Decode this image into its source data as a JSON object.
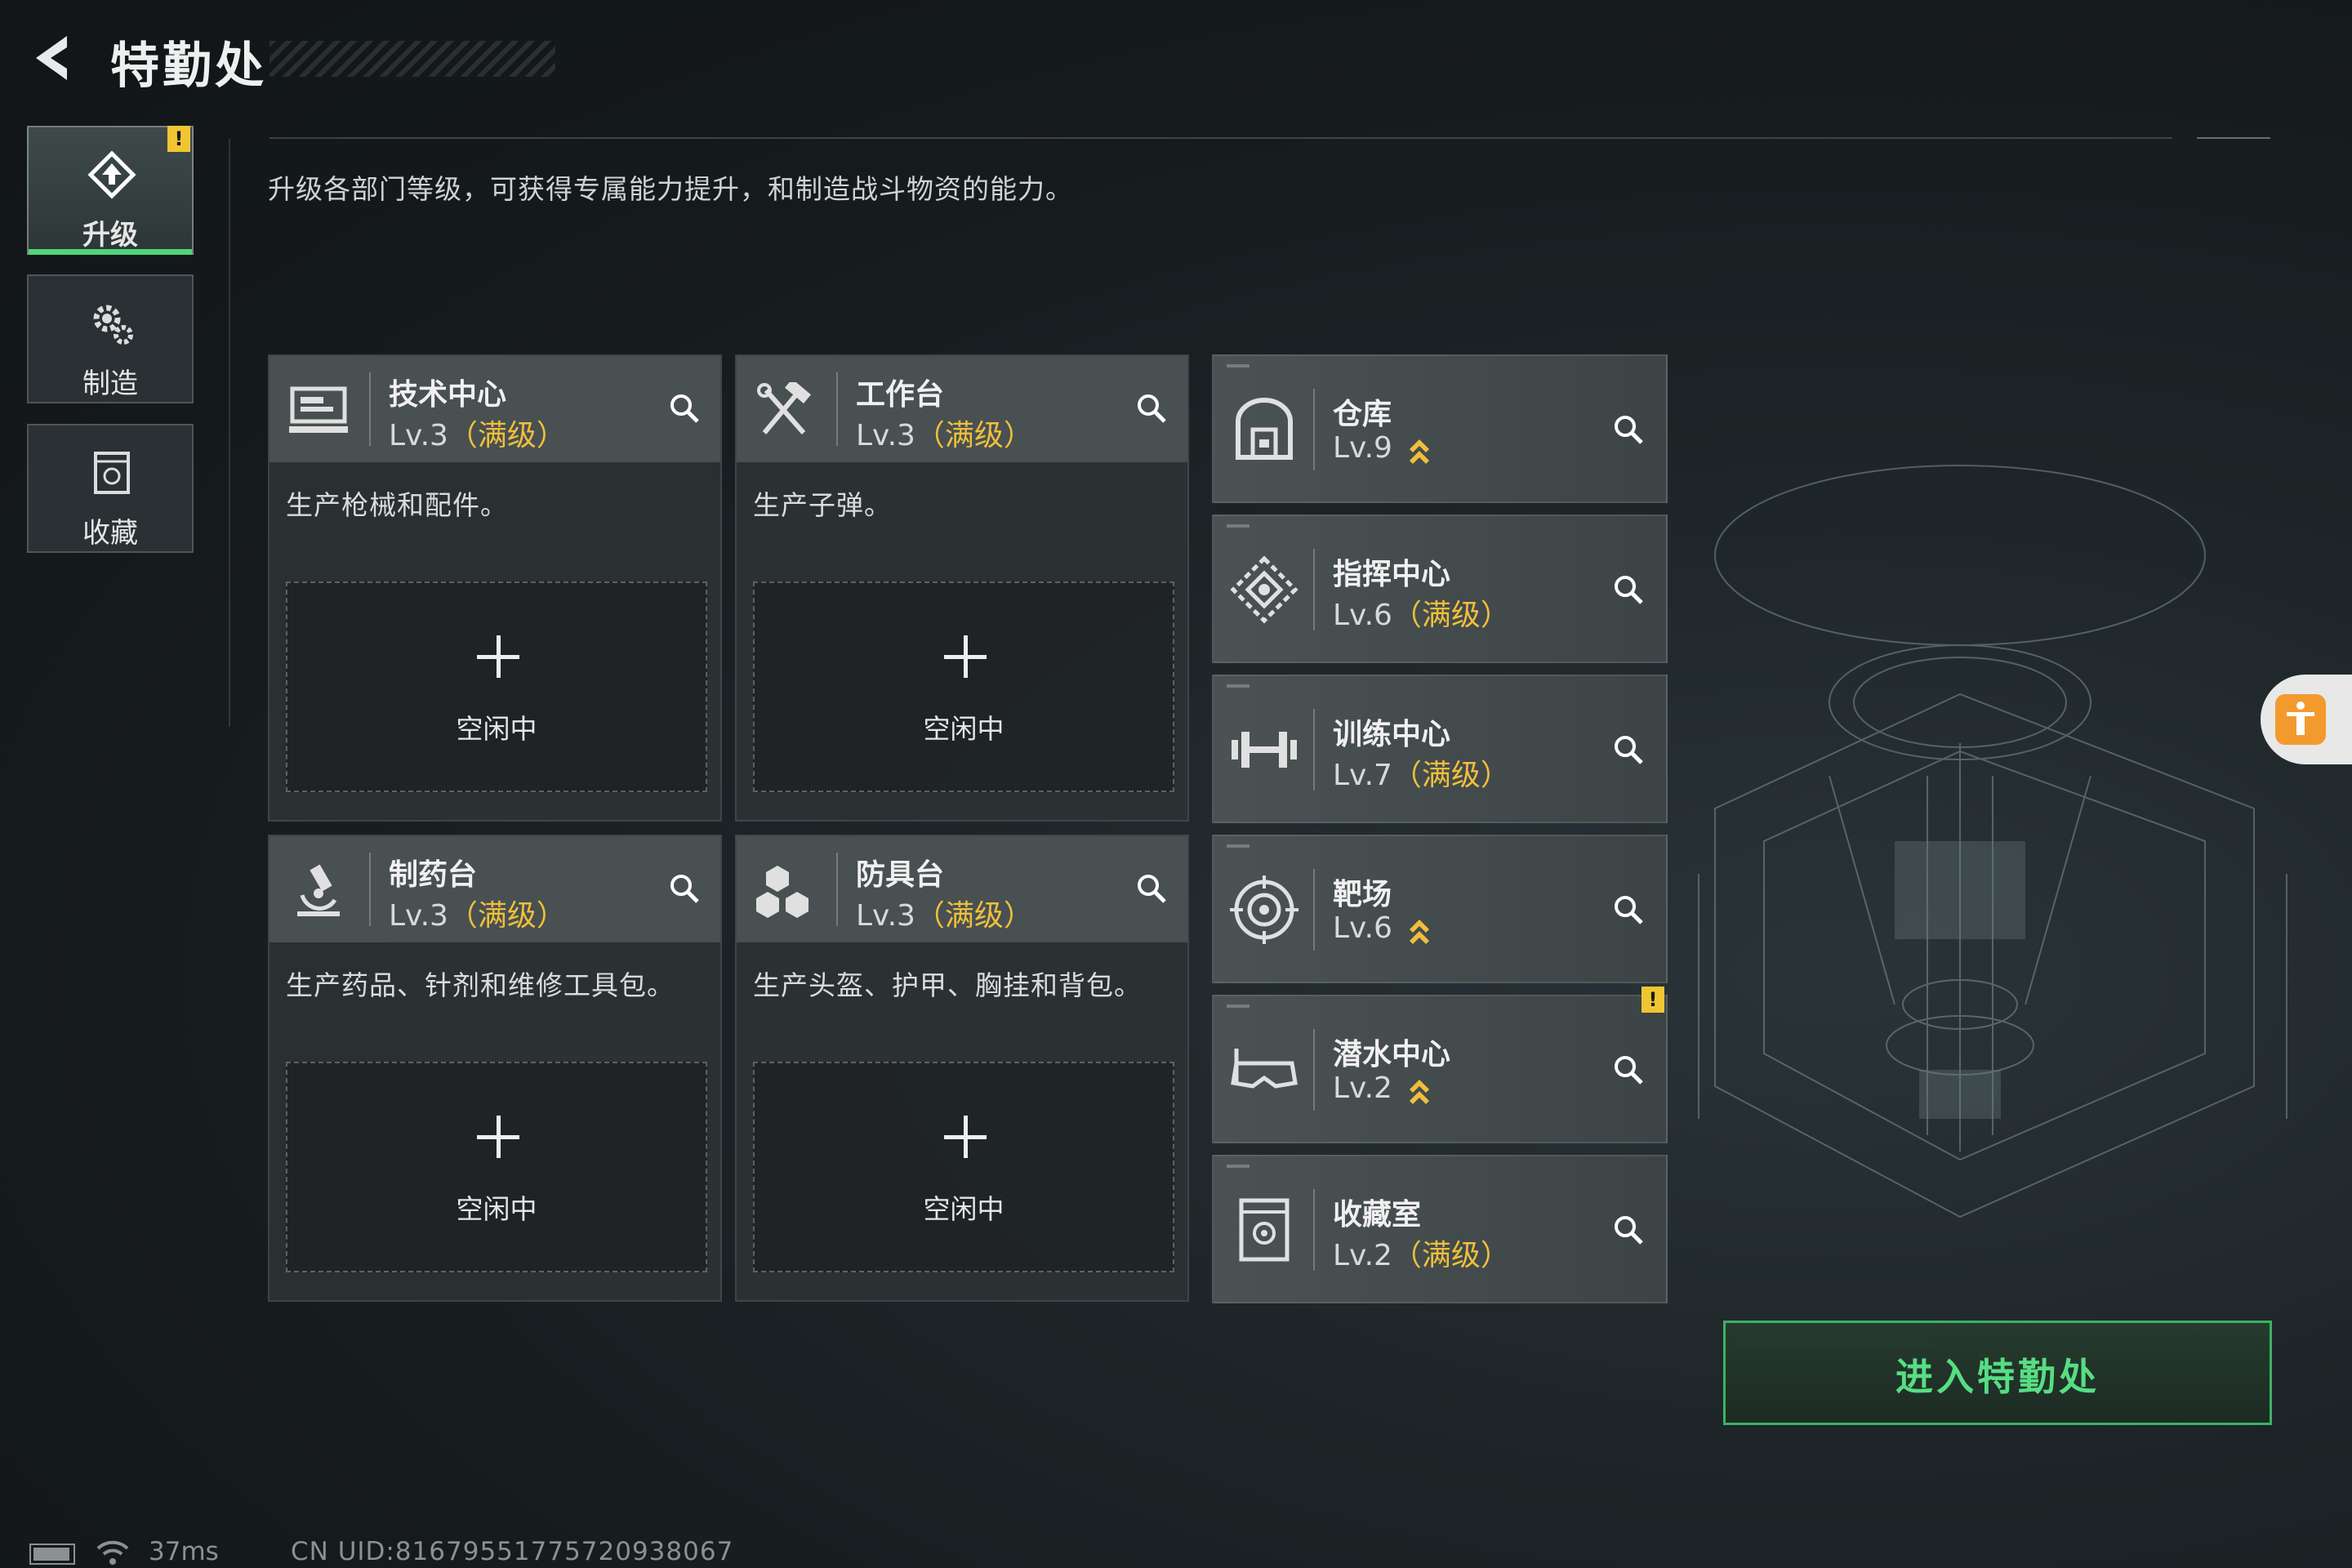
{
  "header": {
    "title": "特勤处"
  },
  "description": "升级各部门等级，可获得专属能力提升，和制造战斗物资的能力。",
  "nav": [
    {
      "label": "升级",
      "icon": "upgrade-icon",
      "active": true,
      "alert": "!"
    },
    {
      "label": "制造",
      "icon": "gears-icon",
      "active": false
    },
    {
      "label": "收藏",
      "icon": "vault-icon",
      "active": false
    }
  ],
  "cards": [
    {
      "name": "技术中心",
      "level": "Lv.3",
      "max": "（满级）",
      "desc": "生产枪械和配件。",
      "slot_label": "空闲中",
      "icon": "computer-icon"
    },
    {
      "name": "工作台",
      "level": "Lv.3",
      "max": "（满级）",
      "desc": "生产子弹。",
      "slot_label": "空闲中",
      "icon": "tools-icon"
    },
    {
      "name": "制药台",
      "level": "Lv.3",
      "max": "（满级）",
      "desc": "生产药品、针剂和维修工具包。",
      "slot_label": "空闲中",
      "icon": "microscope-icon"
    },
    {
      "name": "防具台",
      "level": "Lv.3",
      "max": "（满级）",
      "desc": "生产头盔、护甲、胸挂和背包。",
      "slot_label": "空闲中",
      "icon": "armor-boxes-icon"
    }
  ],
  "facilities": [
    {
      "name": "仓库",
      "level": "Lv.9",
      "max": "",
      "upgradable": true,
      "icon": "warehouse-icon"
    },
    {
      "name": "指挥中心",
      "level": "Lv.6",
      "max": "（满级）",
      "upgradable": false,
      "icon": "command-icon"
    },
    {
      "name": "训练中心",
      "level": "Lv.7",
      "max": "（满级）",
      "upgradable": false,
      "icon": "dumbbell-icon"
    },
    {
      "name": "靶场",
      "level": "Lv.6",
      "max": "",
      "upgradable": true,
      "icon": "target-icon"
    },
    {
      "name": "潜水中心",
      "level": "Lv.2",
      "max": "",
      "upgradable": true,
      "alert": "!",
      "icon": "diving-mask-icon"
    },
    {
      "name": "收藏室",
      "level": "Lv.2",
      "max": "（满级）",
      "upgradable": false,
      "icon": "collection-icon"
    }
  ],
  "enter_button": "进入特勤处",
  "status": {
    "ping": "37ms",
    "uid": "CN UID:8167955177572093806​7"
  },
  "colors": {
    "accent_green": "#3bb365",
    "max_gold": "#f0bf3a",
    "alert_yellow": "#f1c532"
  }
}
